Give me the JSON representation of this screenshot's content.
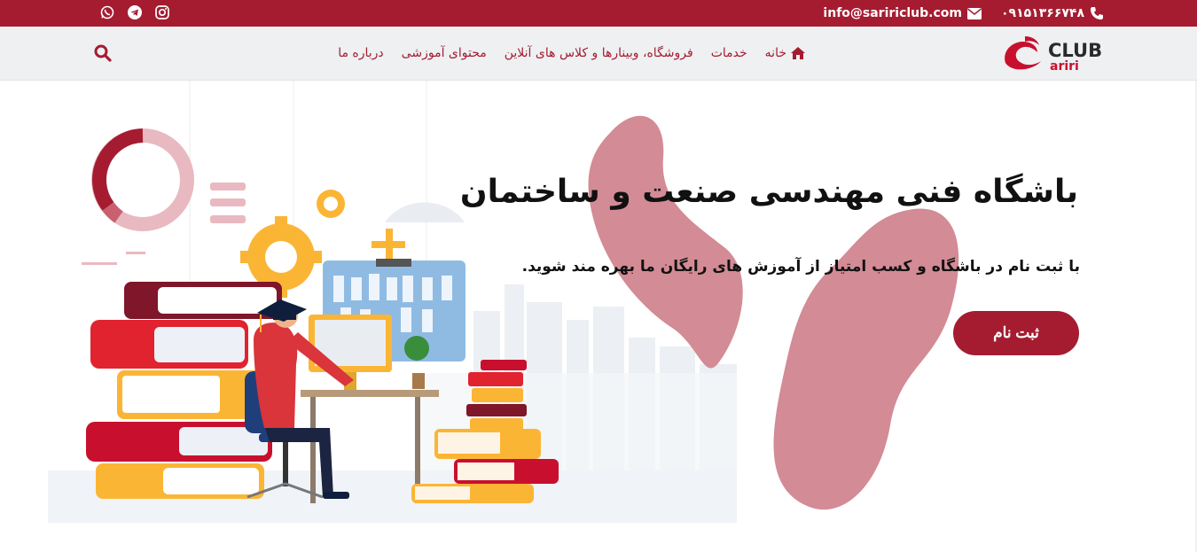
{
  "topbar": {
    "phone": "۰۹۱۵۱۳۶۶۷۴۸",
    "email": "info@saririclub.com",
    "socials": [
      "whatsapp-icon",
      "telegram-icon",
      "instagram-icon"
    ]
  },
  "logo": {
    "top_text": "CLUB",
    "bottom_text": "ariri"
  },
  "nav": {
    "items": [
      {
        "label": "خانه",
        "icon": "home-icon"
      },
      {
        "label": "خدمات"
      },
      {
        "label": "فروشگاه، وبینارها و کلاس های آنلاین"
      },
      {
        "label": "محتوای آموزشی"
      },
      {
        "label": "درباره ما"
      }
    ],
    "search_icon": "search-icon"
  },
  "hero": {
    "title": "باشگاه فنی مهندسی صنعت و ساختمان",
    "subtitle": "با ثبت نام در باشگاه و کسب امتیاز از آموزش های رایگان ما بهره مند شوید.",
    "cta_label": "ثبت نام"
  },
  "colors": {
    "brand": "#a51c30",
    "blob": "#d38b95",
    "nav_bg": "#eef0f2"
  }
}
